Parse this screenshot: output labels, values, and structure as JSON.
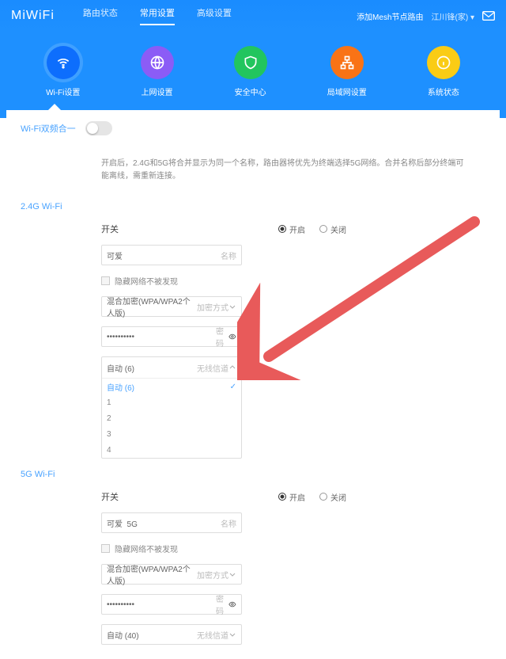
{
  "header": {
    "logo": "MiWiFi",
    "nav": {
      "status": "路由状态",
      "common": "常用设置",
      "advanced": "高级设置"
    },
    "addMesh": "添加Mesh节点路由",
    "userLabel": "江川锋(家)"
  },
  "tabs": {
    "wifi": "Wi-Fi设置",
    "wan": "上网设置",
    "sec": "安全中心",
    "lan": "局域网设置",
    "sys": "系统状态"
  },
  "merge": {
    "title": "Wi-Fi双频合一",
    "desc": "开启后，2.4G和5G将合并显示为同一个名称，路由器将优先为终端选择5G网络。合并名称后部分终端可能离线，需重新连接。"
  },
  "common": {
    "switchLabel": "开关",
    "onLabel": "开启",
    "offLabel": "关闭",
    "nameSuffix": "名称",
    "hideLabel": "隐藏网络不被发现",
    "encSuffix": "加密方式",
    "pwdSuffix": "密码",
    "chanSuffix": "无线信道",
    "encValue": "混合加密(WPA/WPA2个人版)",
    "pwdMask": "••••••••••"
  },
  "g24": {
    "title": "2.4G Wi-Fi",
    "name": "可爱",
    "chanSelected": "自动 (6)",
    "chanOptions": [
      "自动 (6)",
      "1",
      "2",
      "3",
      "4"
    ]
  },
  "g5": {
    "title": "5G Wi-Fi",
    "name": "可爱_5G",
    "chanSelected": "自动 (40)"
  }
}
